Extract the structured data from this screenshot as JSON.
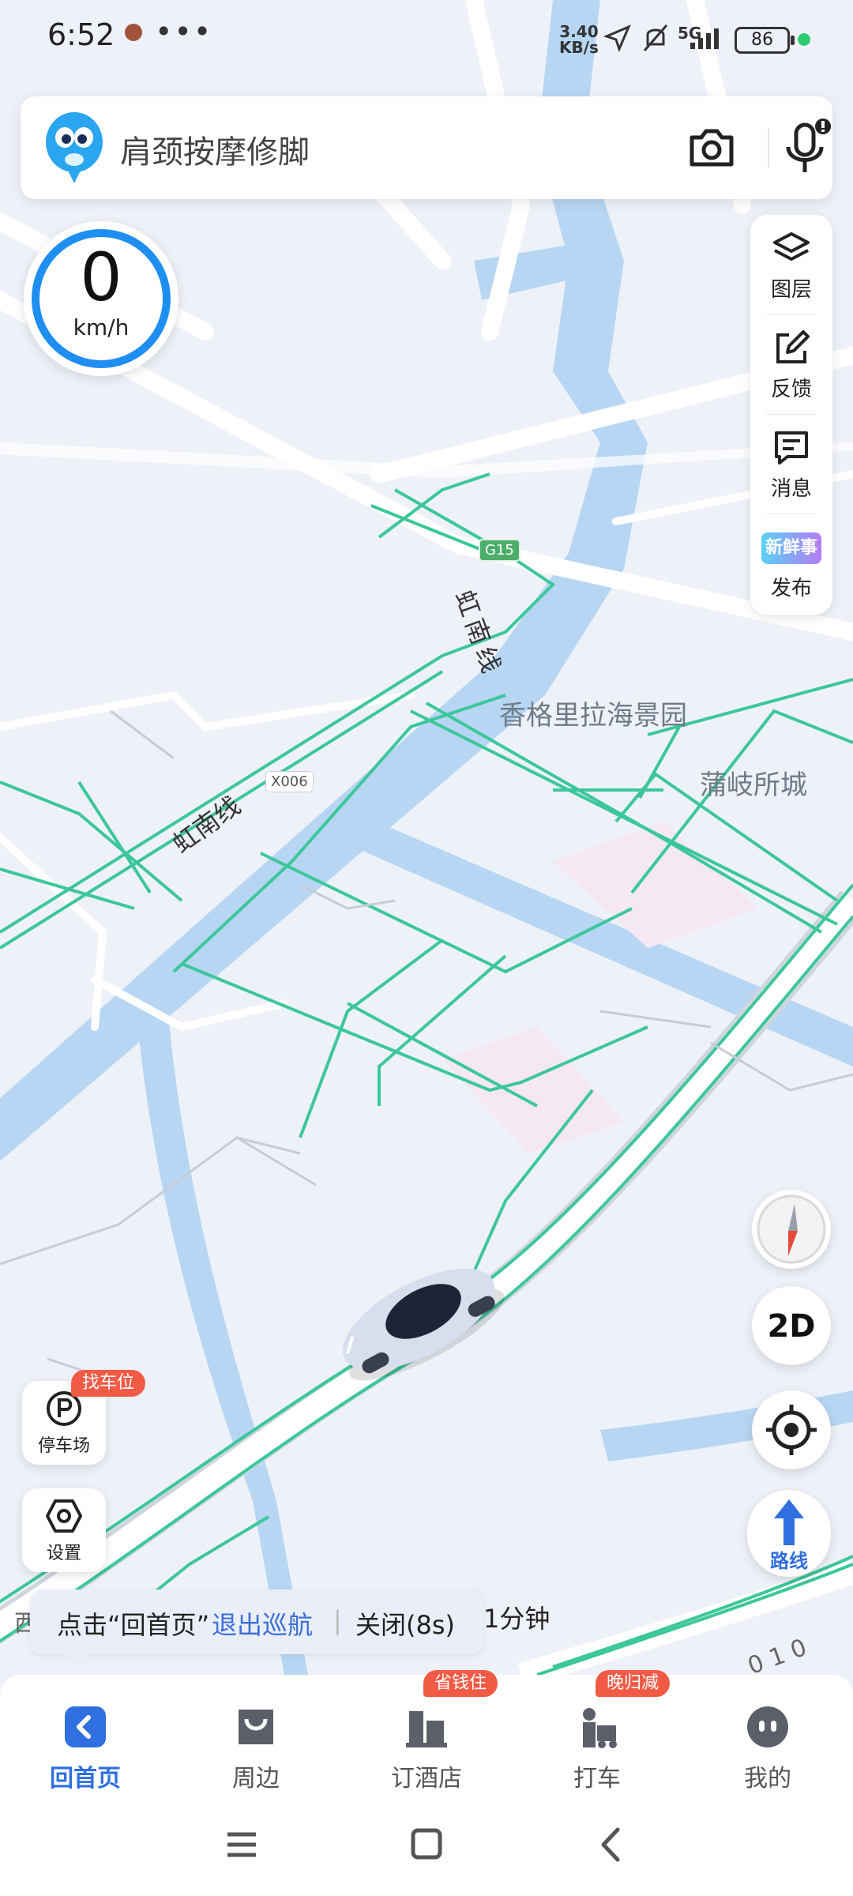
{
  "status_bar": {
    "time": "6:52",
    "more": "•••",
    "speed_top": "3.40",
    "speed_unit": "KB/s",
    "network": "5G",
    "battery": "86"
  },
  "search": {
    "placeholder": "肩颈按摩修脚",
    "camera_icon": "camera-icon",
    "mic_icon": "microphone-icon"
  },
  "speedometer": {
    "value": "0",
    "unit": "km/h"
  },
  "right_panel": [
    {
      "label": "图层",
      "icon": "layers-icon"
    },
    {
      "label": "反馈",
      "icon": "feedback-icon"
    },
    {
      "label": "消息",
      "icon": "message-icon"
    },
    {
      "label": "发布",
      "icon": "new-story-icon",
      "badge_text": "新鲜事"
    }
  ],
  "map": {
    "poi": [
      "香格里拉海景园",
      "蒲岐所城"
    ],
    "roads": [
      "虹南线",
      "虹南线"
    ],
    "shields": [
      "G15",
      "X006"
    ],
    "bottom_fragment": "西",
    "corner_fragment": "0 1 0"
  },
  "controls": {
    "mode": "2D",
    "route": "路线",
    "compass_icon": "compass-icon",
    "locate_icon": "locate-icon"
  },
  "left_buttons": [
    {
      "label": "停车场",
      "badge": "找车位",
      "icon": "parking-icon"
    },
    {
      "label": "设置",
      "icon": "settings-icon"
    }
  ],
  "toast": {
    "prefix": "点击“回首页”",
    "action": "退出巡航",
    "separator": "|",
    "close": "关闭(8s)"
  },
  "eta": "1分钟",
  "bottom_nav": [
    {
      "label": "回首页",
      "active": true,
      "icon": "back-home-icon"
    },
    {
      "label": "周边",
      "icon": "nearby-icon"
    },
    {
      "label": "订酒店",
      "badge": "省钱住",
      "icon": "hotel-icon"
    },
    {
      "label": "打车",
      "badge": "晚归减",
      "icon": "taxi-icon"
    },
    {
      "label": "我的",
      "icon": "profile-icon"
    }
  ],
  "colors": {
    "accent": "#2f6fe0",
    "road_green": "#3cc79a",
    "water": "#b7d6f3",
    "badge": "#f15a45"
  }
}
